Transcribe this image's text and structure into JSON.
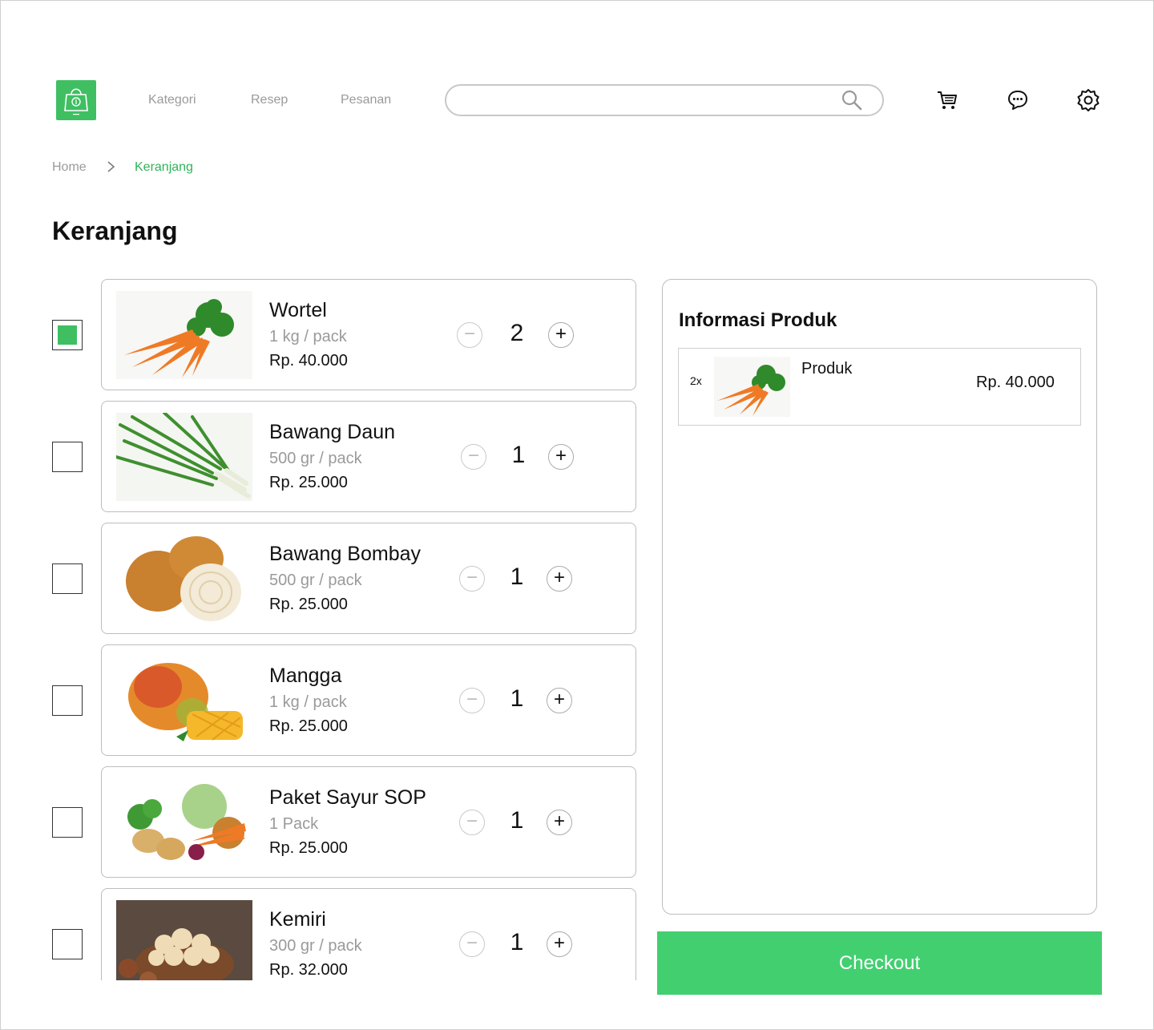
{
  "header": {
    "nav": [
      "Kategori",
      "Resep",
      "Pesanan"
    ],
    "search": {
      "placeholder": ""
    },
    "icons": [
      "cart-icon",
      "chat-icon",
      "settings-icon"
    ]
  },
  "breadcrumb": {
    "home": "Home",
    "current": "Keranjang"
  },
  "page_title": "Keranjang",
  "cart": {
    "items": [
      {
        "name": "Wortel",
        "unit": "1 kg / pack",
        "price": "Rp. 40.000",
        "qty": "2",
        "checked": true
      },
      {
        "name": "Bawang Daun",
        "unit": "500 gr / pack",
        "price": "Rp. 25.000",
        "qty": "1",
        "checked": false
      },
      {
        "name": "Bawang Bombay",
        "unit": "500 gr / pack",
        "price": "Rp. 25.000",
        "qty": "1",
        "checked": false
      },
      {
        "name": "Mangga",
        "unit": "1  kg / pack",
        "price": "Rp. 25.000",
        "qty": "1",
        "checked": false
      },
      {
        "name": "Paket Sayur SOP",
        "unit": "1  Pack",
        "price": "Rp. 25.000",
        "qty": "1",
        "checked": false
      },
      {
        "name": "Kemiri",
        "unit": "300 gr / pack",
        "price": "Rp. 32.000",
        "qty": "1",
        "checked": false
      }
    ]
  },
  "summary": {
    "title": "Informasi Produk",
    "item": {
      "qty": "2x",
      "label": "Produk",
      "price": "Rp. 40.000"
    }
  },
  "checkout_label": "Checkout",
  "colors": {
    "accent": "#3fbf62",
    "checkout": "#42cf70",
    "muted": "#9a9a9a"
  }
}
